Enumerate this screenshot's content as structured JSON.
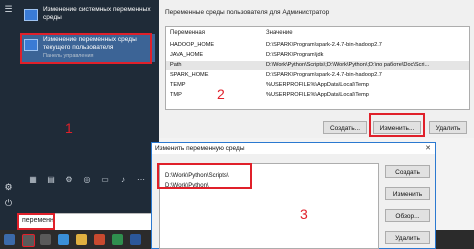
{
  "search": {
    "results": [
      {
        "title": "Изменение системных переменных среды",
        "subtitle": ""
      },
      {
        "title": "Изменение переменных среды текущего пользователя",
        "subtitle": "Панель управления"
      }
    ],
    "query": "переменн"
  },
  "env_dialog": {
    "title": "Переменные среды пользователя для Администратор",
    "columns": [
      "Переменная",
      "Значение"
    ],
    "rows": [
      {
        "name": "HADOOP_HOME",
        "value": "D:\\SPARK\\Program\\spark-2.4.7-bin-hadoop2.7"
      },
      {
        "name": "JAVA_HOME",
        "value": "D:\\SPARK\\Program\\jdk"
      },
      {
        "name": "Path",
        "value": "D:\\Work\\Python\\Scripts\\;D:\\Work\\Python\\;D:\\по работе\\Doc\\Scri..."
      },
      {
        "name": "SPARK_HOME",
        "value": "D:\\SPARK\\Program\\spark-2.4.7-bin-hadoop2.7"
      },
      {
        "name": "TEMP",
        "value": "%USERPROFILE%\\AppData\\Local\\Temp"
      },
      {
        "name": "TMP",
        "value": "%USERPROFILE%\\AppData\\Local\\Temp"
      }
    ],
    "buttons": {
      "create": "Создать...",
      "edit": "Изменить...",
      "delete": "Удалить"
    }
  },
  "edit_dialog": {
    "title": "Изменить переменную среды",
    "close": "✕",
    "items": [
      "D:\\Work\\Python\\Scripts\\",
      "D:\\Work\\Python\\"
    ],
    "buttons": {
      "create": "Создать",
      "edit": "Изменить",
      "browse": "Обзор...",
      "delete": "Удалить"
    }
  },
  "annotations": {
    "one": "1",
    "two": "2",
    "three": "3"
  },
  "colors": {
    "highlight": "#e0202a",
    "start_panel": "#1f2b38",
    "accent": "#2b79d0"
  }
}
